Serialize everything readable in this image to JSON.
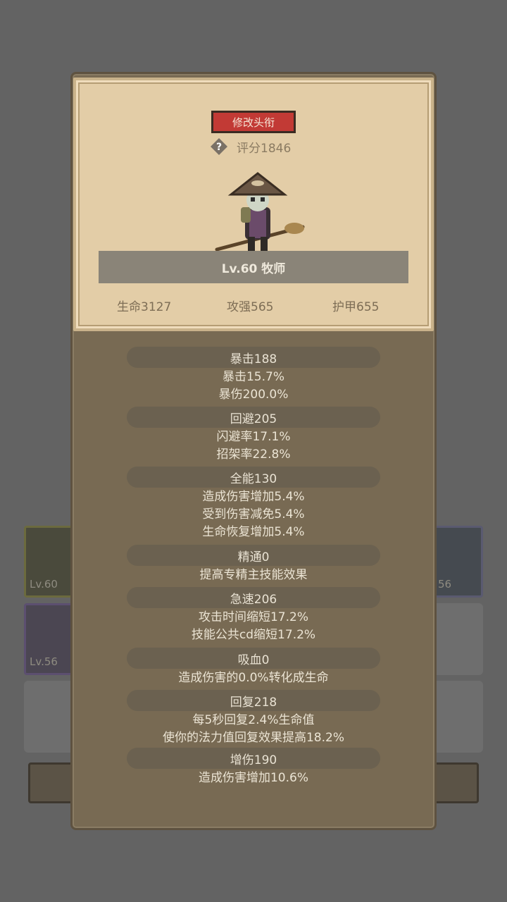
{
  "background": {
    "slot_levels": [
      "Lv.60",
      "Lv.56",
      "56"
    ]
  },
  "card": {
    "rename_button": "修改头衔",
    "score": "评分1846",
    "level_title": "Lv.60 牧师",
    "base_stats": [
      "生命3127",
      "攻强565",
      "护甲655"
    ]
  },
  "stats": {
    "crit": {
      "header": "暴击188",
      "lines": [
        "暴击15.7%",
        "暴伤200.0%"
      ]
    },
    "dodge": {
      "header": "回避205",
      "lines": [
        "闪避率17.1%",
        "招架率22.8%"
      ]
    },
    "versatility": {
      "header": "全能130",
      "lines": [
        "造成伤害增加5.4%",
        "受到伤害减免5.4%",
        "生命恢复增加5.4%"
      ]
    },
    "mastery": {
      "header": "精通0",
      "lines": [
        "提高专精主技能效果"
      ]
    },
    "haste": {
      "header": "急速206",
      "lines": [
        "攻击时间缩短17.2%",
        "技能公共cd缩短17.2%"
      ]
    },
    "leech": {
      "header": "吸血0",
      "lines": [
        "造成伤害的0.0%转化成生命"
      ]
    },
    "regen": {
      "header": "回复218",
      "lines": [
        "每5秒回复2.4%生命值",
        "使你的法力值回复效果提高18.2%"
      ]
    },
    "damage": {
      "header": "增伤190",
      "lines": [
        "造成伤害增加10.6%"
      ]
    }
  },
  "colors": {
    "accent_red": "#c23a35",
    "parchment": "#e3cda7",
    "panel": "#786a53"
  }
}
